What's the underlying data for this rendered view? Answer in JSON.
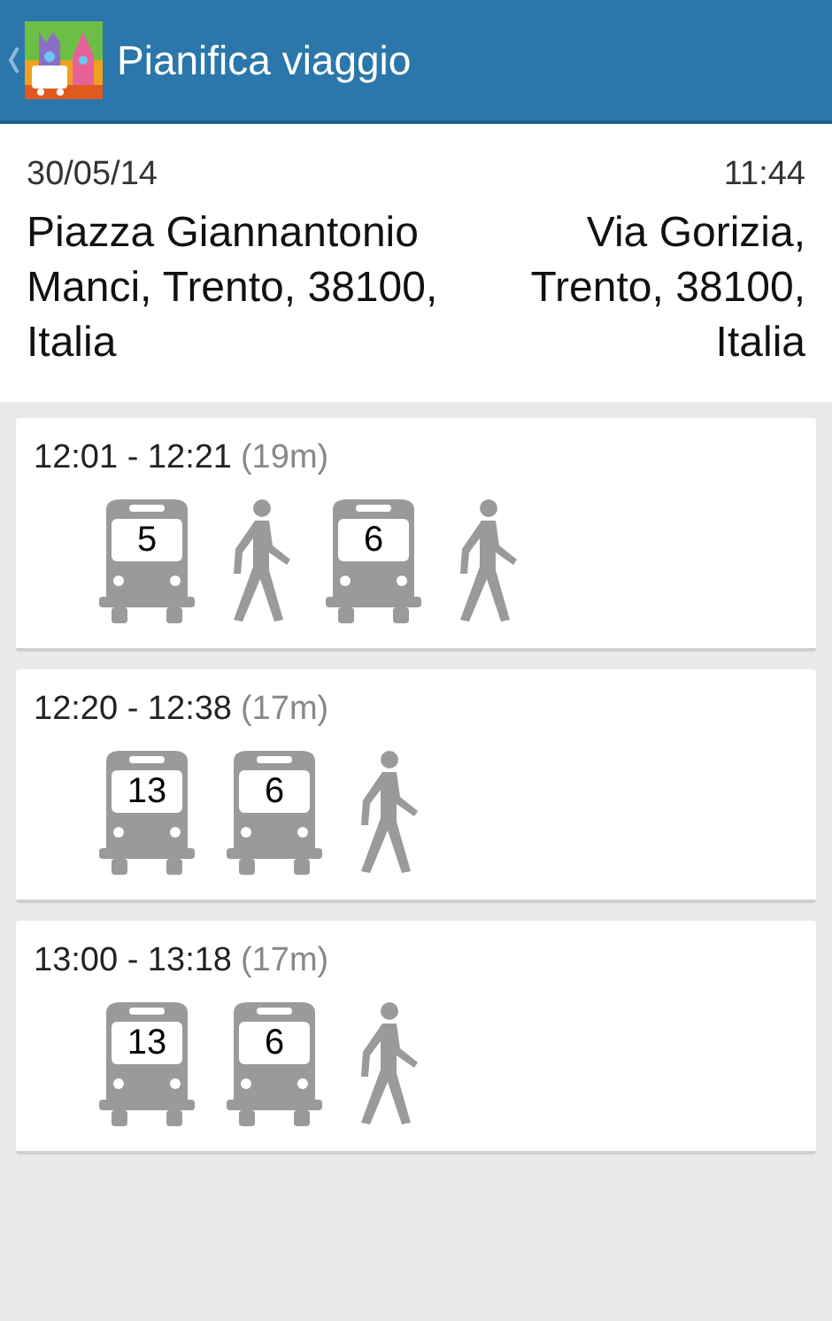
{
  "header": {
    "title": "Pianifica viaggio"
  },
  "trip": {
    "date": "30/05/14",
    "time": "11:44",
    "from": "Piazza Giannantonio Manci, Trento, 38100, Italia",
    "to": "Via Gorizia, Trento, 38100, Italia"
  },
  "itineraries": [
    {
      "times": "12:01 - 12:21",
      "duration": "(19m)",
      "legs": [
        {
          "kind": "bus",
          "line": "5"
        },
        {
          "kind": "walk"
        },
        {
          "kind": "bus",
          "line": "6"
        },
        {
          "kind": "walk"
        }
      ]
    },
    {
      "times": "12:20 - 12:38",
      "duration": "(17m)",
      "legs": [
        {
          "kind": "bus",
          "line": "13"
        },
        {
          "kind": "bus",
          "line": "6"
        },
        {
          "kind": "walk"
        }
      ]
    },
    {
      "times": "13:00 - 13:18",
      "duration": "(17m)",
      "legs": [
        {
          "kind": "bus",
          "line": "13"
        },
        {
          "kind": "bus",
          "line": "6"
        },
        {
          "kind": "walk"
        }
      ]
    }
  ]
}
